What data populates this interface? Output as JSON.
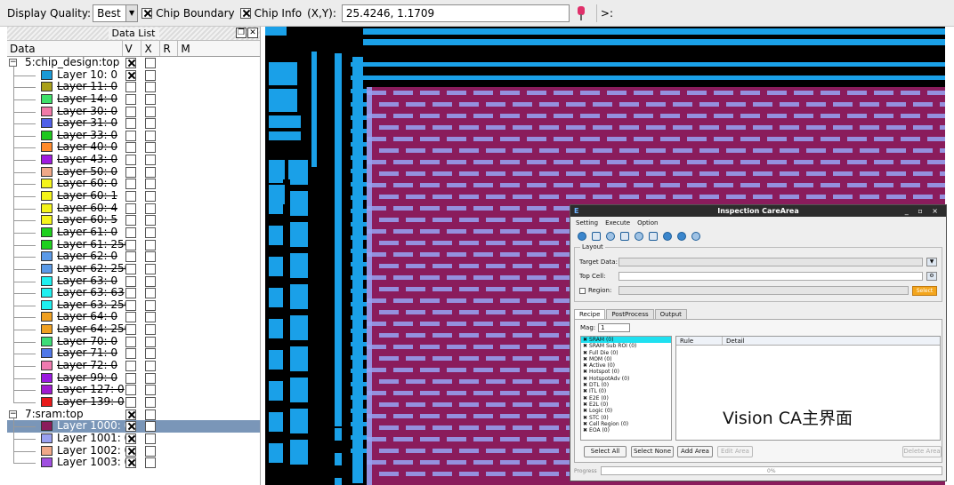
{
  "toolbar": {
    "display_quality_label": "Display Quality:",
    "display_quality_value": "Best",
    "chip_boundary_label": "Chip Boundary",
    "chip_info_label": "Chip Info",
    "xy_label": "(X,Y):",
    "xy_value": "25.4246, 1.1709",
    "prompt": ">:"
  },
  "panel": {
    "title": "Data List",
    "columns": [
      "Data",
      "V",
      "X",
      "R",
      "M"
    ],
    "rows": [
      {
        "type": "group",
        "label": "5:chip_design:top",
        "v": true
      },
      {
        "type": "layer",
        "label": "Layer 10: 0",
        "color": "#1a9ad6",
        "v": true,
        "strike": false
      },
      {
        "type": "layer",
        "label": "Layer 11: 0",
        "color": "#a9a01a",
        "v": false,
        "strike": true
      },
      {
        "type": "layer",
        "label": "Layer 14: 0",
        "color": "#3fe06a",
        "v": false,
        "strike": true
      },
      {
        "type": "layer",
        "label": "Layer 30: 0",
        "color": "#f07aa8",
        "v": false,
        "strike": true
      },
      {
        "type": "layer",
        "label": "Layer 31: 0",
        "color": "#4f5fe8",
        "v": false,
        "strike": true
      },
      {
        "type": "layer",
        "label": "Layer 33: 0",
        "color": "#1ec81e",
        "v": false,
        "strike": true
      },
      {
        "type": "layer",
        "label": "Layer 40: 0",
        "color": "#ff8a2a",
        "v": false,
        "strike": true
      },
      {
        "type": "layer",
        "label": "Layer 43: 0",
        "color": "#a01ae0",
        "v": false,
        "strike": true
      },
      {
        "type": "layer",
        "label": "Layer 50: 0",
        "color": "#f0a888",
        "v": false,
        "strike": true
      },
      {
        "type": "layer",
        "label": "Layer 60: 0",
        "color": "#f4f41a",
        "v": false,
        "strike": true
      },
      {
        "type": "layer",
        "label": "Layer 60: 1",
        "color": "#f4f41a",
        "v": false,
        "strike": true
      },
      {
        "type": "layer",
        "label": "Layer 60: 4",
        "color": "#f4f41a",
        "v": false,
        "strike": true
      },
      {
        "type": "layer",
        "label": "Layer 60: 5",
        "color": "#f4f41a",
        "v": false,
        "strike": true
      },
      {
        "type": "layer",
        "label": "Layer 61: 0",
        "color": "#1ed01e",
        "v": false,
        "strike": true
      },
      {
        "type": "layer",
        "label": "Layer 61: 250",
        "color": "#1ed01e",
        "v": false,
        "strike": true
      },
      {
        "type": "layer",
        "label": "Layer 62: 0",
        "color": "#5a9ae8",
        "v": false,
        "strike": true
      },
      {
        "type": "layer",
        "label": "Layer 62: 250",
        "color": "#5a9ae8",
        "v": false,
        "strike": true
      },
      {
        "type": "layer",
        "label": "Layer 63: 0",
        "color": "#1ef0f0",
        "v": false,
        "strike": true
      },
      {
        "type": "layer",
        "label": "Layer 63: 63",
        "color": "#1ef0f0",
        "v": false,
        "strike": true
      },
      {
        "type": "layer",
        "label": "Layer 63: 250",
        "color": "#1ef0f0",
        "v": false,
        "strike": true
      },
      {
        "type": "layer",
        "label": "Layer 64: 0",
        "color": "#f0a020",
        "v": false,
        "strike": true
      },
      {
        "type": "layer",
        "label": "Layer 64: 250",
        "color": "#f0a020",
        "v": false,
        "strike": true
      },
      {
        "type": "layer",
        "label": "Layer 70: 0",
        "color": "#3cdc78",
        "v": false,
        "strike": true
      },
      {
        "type": "layer",
        "label": "Layer 71: 0",
        "color": "#5078e8",
        "v": false,
        "strike": true
      },
      {
        "type": "layer",
        "label": "Layer 72: 0",
        "color": "#f07ab0",
        "v": false,
        "strike": true
      },
      {
        "type": "layer",
        "label": "Layer 99: 0",
        "color": "#9a1ae0",
        "v": false,
        "strike": true
      },
      {
        "type": "layer",
        "label": "Layer 127: 0",
        "color": "#a01ad0",
        "v": false,
        "strike": true
      },
      {
        "type": "layer",
        "label": "Layer 139: 0",
        "color": "#e81a1a",
        "v": false,
        "strike": true
      },
      {
        "type": "group",
        "label": "7:sram:top",
        "v": true
      },
      {
        "type": "layer",
        "label": "Layer 1000: 0",
        "color": "#8a1c5c",
        "v": true,
        "strike": false,
        "selected": true
      },
      {
        "type": "layer",
        "label": "Layer 1001: 0",
        "color": "#9aa0f0",
        "v": true,
        "strike": false
      },
      {
        "type": "layer",
        "label": "Layer 1002: 0",
        "color": "#f0a888",
        "v": true,
        "strike": false
      },
      {
        "type": "layer",
        "label": "Layer 1003: 0",
        "color": "#a050e0",
        "v": true,
        "strike": false
      }
    ]
  },
  "dialog": {
    "title": "Inspection CareArea",
    "logo": "E",
    "window_buttons": "_ ▫ ×",
    "menu": [
      "Setting",
      "Execute",
      "Option"
    ],
    "layout_legend": "Layout",
    "target_label": "Target Data:",
    "topcell_label": "Top Cell:",
    "region_label": "Region:",
    "select_button": "Select",
    "tabs": [
      "Recipe",
      "PostProcess",
      "Output"
    ],
    "mag_label": "Mag:",
    "mag_value": "1",
    "categories": [
      "SRAM (0)",
      "SRAM Sub ROI (0)",
      "Full Die (0)",
      "MOM (0)",
      "Active (0)",
      "Hotspot (0)",
      "HotspotAdv (0)",
      "DTL (0)",
      "ITL (0)",
      "E2E (0)",
      "E2L (0)",
      "Logic (0)",
      "STC (0)",
      "Cell Region (0)",
      "EOA (0)"
    ],
    "rule_columns": [
      "Rule",
      "Detail"
    ],
    "buttons": {
      "select_all": "Select All",
      "select_none": "Select None",
      "add_area": "Add Area",
      "edit_area": "Edit Area",
      "delete_area": "Delete Area"
    },
    "progress_label": "Progress",
    "progress_value": "0%",
    "progress_fraction": 0.0
  },
  "caption": "Vision CA主界面",
  "colors": {
    "accent_blue": "#1aa0e8",
    "magenta": "#8a1c5c",
    "lavender": "#9aa0f0",
    "selection": "#7a96b8"
  }
}
